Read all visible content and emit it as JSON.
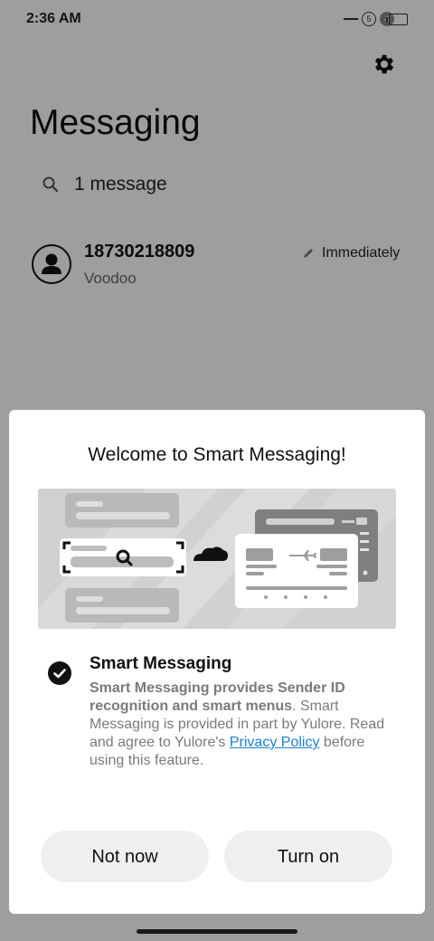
{
  "status": {
    "time": "2:36 AM",
    "sim1": "5",
    "sim2": "4"
  },
  "app": {
    "title": "Messaging",
    "search_placeholder": "1 message"
  },
  "conversation": {
    "sender": "18730218809",
    "preview": "Voodoo",
    "time": "Immediately"
  },
  "dialog": {
    "title": "Welcome to Smart Messaging!",
    "option_title": "Smart Messaging",
    "desc_bold": "Smart Messaging provides Sender ID recognition and smart menus",
    "desc_after_bold": ". Smart Messaging is provided in part by Yulore. Read and agree to Yulore's ",
    "link_text": "Privacy Policy",
    "desc_end": " before using this feature.",
    "not_now": "Not now",
    "turn_on": "Turn on",
    "colors": {
      "link": "#1a7fd6",
      "scrim": "rgba(0,0,0,0.38)"
    }
  },
  "icons": [
    "settings-gear-icon",
    "search-icon",
    "avatar-person-icon",
    "draft-pencil-icon",
    "checkmark-icon"
  ]
}
